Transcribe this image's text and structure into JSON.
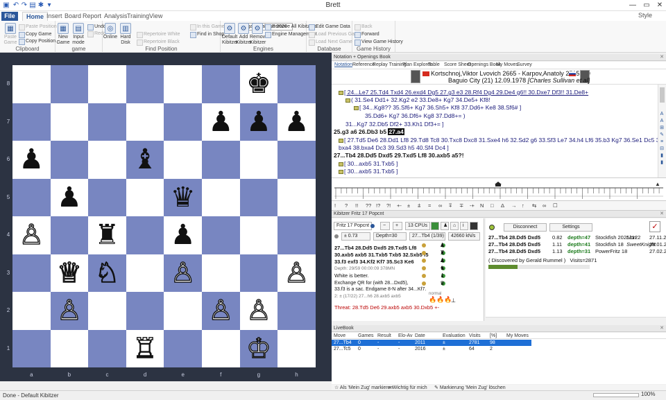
{
  "window": {
    "title": "Brett",
    "style_label": "Style"
  },
  "ribbon": {
    "tabs": [
      "File",
      "Home",
      "Insert",
      "Board",
      "Report",
      "Analysis",
      "Training",
      "View"
    ],
    "clipboard": {
      "label": "Clipboard",
      "paste": "Paste Game",
      "paste_position": "Paste Position",
      "copy_game": "Copy Game",
      "copy_position": "Copy Position"
    },
    "game": {
      "label": "game",
      "new_game": "New Game",
      "input_mode": "Input mode",
      "undo": "Undo",
      "redo": "Redo"
    },
    "find_position": {
      "label": "Find Position",
      "online": "Online",
      "hard_disk": "Hard Disk",
      "database": "Mega Database 2026",
      "in_this_game": "In this Game",
      "repertoire_white": "Repertoire White",
      "repertoire_black": "Repertoire Black",
      "find_in_shop": "Find in Shop"
    },
    "engines": {
      "label": "Engines",
      "default_kibitzer": "Default Kibitzer",
      "add_kibitzer": "Add Kibitzer",
      "remove_kibitzer": "Remove Kibitzer",
      "remove_all": "Remove All Kibitzers",
      "engine_mgmt": "Engine Management"
    },
    "database": {
      "label": "Database",
      "edit_game_data": "Edit Game Data",
      "load_previous": "Load Previous Game",
      "load_next": "Load Next Game"
    },
    "game_history": {
      "label": "Game History",
      "back": "Back",
      "forward": "Forward",
      "view_history": "View Game History"
    }
  },
  "board": {
    "files": [
      "a",
      "b",
      "c",
      "d",
      "e",
      "f",
      "g",
      "h"
    ],
    "ranks": [
      "8",
      "7",
      "6",
      "5",
      "4",
      "3",
      "2",
      "1"
    ],
    "pieces": [
      {
        "sq": "g8",
        "glyph": "♚",
        "color": "black"
      },
      {
        "sq": "f7",
        "glyph": "♟",
        "color": "black"
      },
      {
        "sq": "g7",
        "glyph": "♟",
        "color": "black"
      },
      {
        "sq": "h7",
        "glyph": "♟",
        "color": "black"
      },
      {
        "sq": "a6",
        "glyph": "♟",
        "color": "black"
      },
      {
        "sq": "d6",
        "glyph": "♝",
        "color": "black"
      },
      {
        "sq": "b5",
        "glyph": "♟",
        "color": "black"
      },
      {
        "sq": "e5",
        "glyph": "♛",
        "color": "black"
      },
      {
        "sq": "a4",
        "glyph": "♙",
        "color": "white"
      },
      {
        "sq": "c4",
        "glyph": "♜",
        "color": "black"
      },
      {
        "sq": "e4",
        "glyph": "♟",
        "color": "black"
      },
      {
        "sq": "b3",
        "glyph": "♕",
        "color": "white"
      },
      {
        "sq": "c3",
        "glyph": "♘",
        "color": "white"
      },
      {
        "sq": "e3",
        "glyph": "♙",
        "color": "white"
      },
      {
        "sq": "h3",
        "glyph": "♙",
        "color": "white"
      },
      {
        "sq": "b2",
        "glyph": "♙",
        "color": "white"
      },
      {
        "sq": "f2",
        "glyph": "♙",
        "color": "white"
      },
      {
        "sq": "g2",
        "glyph": "♙",
        "color": "white"
      },
      {
        "sq": "d1",
        "glyph": "♖",
        "color": "white"
      },
      {
        "sq": "g1",
        "glyph": "♔",
        "color": "white"
      }
    ]
  },
  "notation_panel": {
    "header": "Notation + Openings Book",
    "tabs": [
      "Notation",
      "Reference",
      "Replay Training",
      "Plan Explorer",
      "Table",
      "Score Sheet",
      "Openings Book",
      "My Moves",
      "Survey"
    ],
    "white_player": "Kortschnoj,Viktor Lvovich",
    "white_elo": "2665",
    "black_player": "Karpov,Anatoly",
    "black_elo": "2725",
    "result": "1-0",
    "event_line": "Baguio City (21) 12.09.1978",
    "annotator": "[Charles Sullivan et al]",
    "lines": [
      "[ 24...Le7 25.Td4 Txd4 26.exd4 Dg5 27.g3 e3 28.Rf4 Dg4 29.De4 g6!! 30.Dxe7 Df3!! 31.De8+",
      "( 31.Se4 Dd1+ 32.Kg2 e2 33.De8+ Kg7 34.De5+ Kf8!",
      "[ 34...Kg8?? 35.Sf6+ Kg7 36.Sh5+ Kf8 37.Dd6+ Ke8 38.Sf6# ]",
      "35.Dd6+ Kg7 36.Df6+ Kg8 37.Dd8+= )",
      "31...Kg7 32.Db5 Df2+ 33.Kh1 Df3+= ]",
      "25.g3 a6 26.Db3 b5",
      "27.a4",
      "[ 27.Td5 De6 28.Dd1 Lf8 29.Td8 Tc8 30.Txc8 Dxc8 31.Sxe4 h6 32.Sd2 g6 33.Sf3 Le7 34.h4 Lf6 35.b3 Kg7 36.Se1 Dc5 37.a4",
      "bxa4 38.bxa4 Dc3 39.Sd3 h5 40.Sf4 Dc4 ]",
      "27...Tb4 28.Dd5 Dxd5 29.Txd5 Lf8 30.axb5 a5?!",
      "[ 30...axb5 31.Txb5 ]",
      "[ 30...axb5 31.Txb5 ]"
    ]
  },
  "symbols_bar": [
    "!",
    "?",
    "!!",
    "??",
    "!?",
    "?!",
    "+-",
    "±",
    "⩲",
    "=",
    "∞",
    "⩱",
    "∓",
    "-+",
    "N",
    "□",
    "Δ",
    "→",
    "↑",
    "⇆",
    "∞",
    "☐"
  ],
  "kibitzer": {
    "header": "Kibitzer Fritz 17 Popcnt",
    "engine_name": "Fritz 17 Popcnt",
    "cpus": "13 CPUs",
    "eval": "± 0.73",
    "depth": "Depth=30",
    "move_counter": "27...Tb4 (1/39)",
    "nps": "42660 kN/s",
    "pv": [
      "27...Tb4 28.Dd5 Dxd5 29.Txd5 Lf8",
      "30.axb5 axb5 31.Txb5 Txb5 32.Sxb5 f5",
      "33.f3 exf3 34.Kf2 Kf7 35.Sc3 Ke6"
    ],
    "depth_info": "Depth: 29/59 00:00:09 378MN",
    "comment1": "White is better.",
    "comment2": "Exchange QR for (with 28...Dxd5),",
    "comment3": "33.f3 is a sac. Endgame 8-N after 34...Kf7.",
    "info_small": "2: ± (17/22)   27...h6 28.axb5 axb5",
    "threat": "Threat: 28.Td5 De6 29.axb5 axb5 30.Dxb5 +-",
    "normal_label": "normal",
    "disconnect": "Disconnect",
    "settings": "Settings",
    "engine_lines": [
      {
        "line": "27...Tb4 28.Dd5 Dxd5",
        "eval": "0.82",
        "depth": "depth=47",
        "engine": "Stockfish 20251122",
        "user": "Lion",
        "date": "27.11.20"
      },
      {
        "line": "27...Tb4 28.Dd5 Dxd5",
        "eval": "1.11",
        "depth": "depth=41",
        "engine": "Stockfish 18",
        "user": "SweetKnight",
        "date": "28.01.20"
      },
      {
        "line": "27...Tb4 28.Dd5 Dxd5",
        "eval": "1.13",
        "depth": "depth=31",
        "engine": "PowerFritz 18",
        "user": "",
        "date": "27.02.20"
      }
    ],
    "discovered": "( Discovered by Gerald Rummel )",
    "visits": "Visits=2871"
  },
  "livebook": {
    "header": "LiveBook",
    "columns": [
      "Move",
      "Games",
      "Result",
      "Elo-Av",
      "Date",
      "Evaluation",
      "Visits",
      "[%]",
      "My Moves"
    ],
    "rows": [
      {
        "move": "27...Tb4",
        "games": "0",
        "result": "-",
        "elo": "-",
        "date": "2011",
        "eval": "±",
        "visits": "2781",
        "pct": "98",
        "selected": true
      },
      {
        "move": "27...Tc5",
        "games": "0",
        "result": "-",
        "elo": "-",
        "date": "2016",
        "eval": "±",
        "visits": "64",
        "pct": "2",
        "selected": false
      }
    ],
    "footer": [
      "Als 'Mein Zug' markieren",
      "Wichtig für mich",
      "Markierung 'Mein Zug' löschen"
    ]
  },
  "status": {
    "text": "Done - Default Kibitzer",
    "zoom": "100%"
  },
  "colors": {
    "dark_square": "#7886c1",
    "light_square": "#ffffff",
    "accent": "#2b579a",
    "selected_row": "#1e6fd6"
  }
}
